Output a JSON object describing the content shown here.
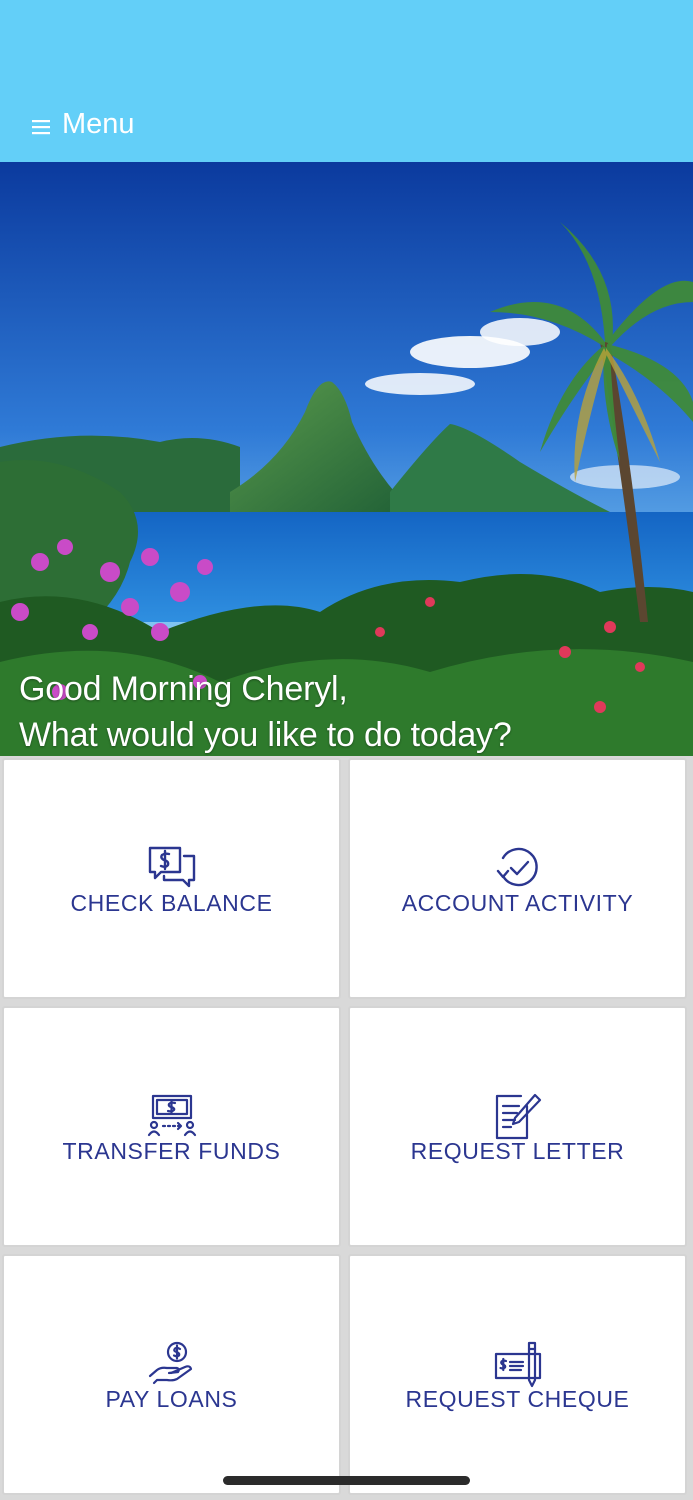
{
  "header": {
    "menu_label": "Menu",
    "background_color": "#63cff8",
    "menu_icon": "hamburger-icon"
  },
  "hero": {
    "image_description_icon": "tropical-landscape-image",
    "greeting_line1": "Good Morning Cheryl,",
    "greeting_line2": "What would you like to do today?"
  },
  "tiles": [
    {
      "label": "CHECK BALANCE",
      "icon": "money-chat-icon"
    },
    {
      "label": "ACCOUNT ACTIVITY",
      "icon": "clock-check-icon"
    },
    {
      "label": "TRANSFER FUNDS",
      "icon": "money-transfer-icon"
    },
    {
      "label": "REQUEST LETTER",
      "icon": "document-pen-icon"
    },
    {
      "label": "PAY LOANS",
      "icon": "hand-coin-icon"
    },
    {
      "label": "REQUEST CHEQUE",
      "icon": "cheque-pen-icon"
    }
  ],
  "colors": {
    "accent_text": "#2b3690",
    "tile_border": "#d4d4d4",
    "tile_background": "#ffffff"
  }
}
